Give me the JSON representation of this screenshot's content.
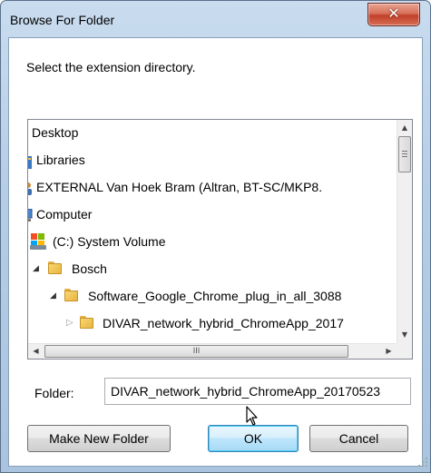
{
  "window": {
    "title": "Browse For Folder",
    "close_glyph": "✕"
  },
  "dialog": {
    "instruction": "Select the extension directory."
  },
  "tree": {
    "items": [
      {
        "label": "Desktop",
        "icon": "desktop-icon"
      },
      {
        "label": "Libraries",
        "icon": "libraries-icon"
      },
      {
        "label": "EXTERNAL Van Hoek Bram (Altran, BT-SC/MKP8.",
        "icon": "user-icon"
      },
      {
        "label": "Computer",
        "icon": "computer-icon"
      },
      {
        "label": "(C:) System Volume",
        "icon": "drive-icon"
      },
      {
        "label": "Bosch",
        "icon": "folder-icon",
        "expander": "expanded"
      },
      {
        "label": "Software_Google_Chrome_plug_in_all_3088",
        "icon": "folder-icon",
        "expander": "expanded"
      },
      {
        "label": "DIVAR_network_hybrid_ChromeApp_2017",
        "icon": "folder-icon",
        "expander": "collapsed",
        "selected": true
      }
    ],
    "scroll_thumb_glyph": "III"
  },
  "folder_field": {
    "label": "Folder:",
    "value": "DIVAR_network_hybrid_ChromeApp_20170523"
  },
  "buttons": {
    "make_new_folder": "Make New Folder",
    "ok": "OK",
    "cancel": "Cancel"
  }
}
